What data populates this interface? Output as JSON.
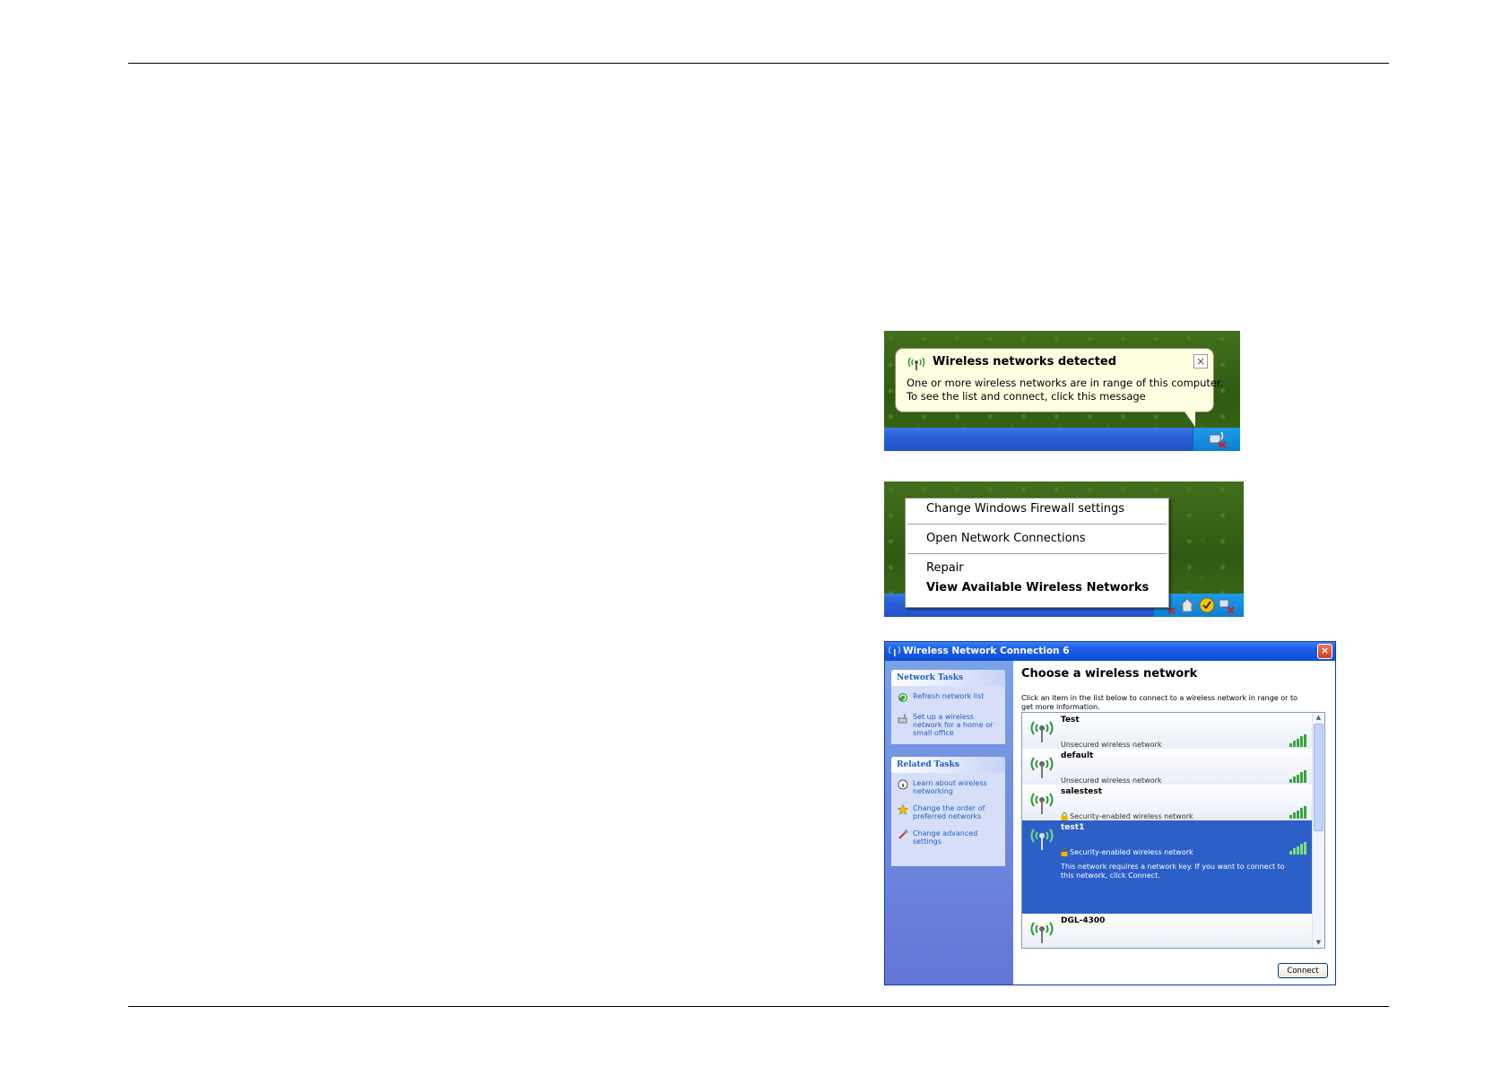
{
  "balloon": {
    "title": "Wireless networks detected",
    "line1": "One or more wireless networks are in range of this computer.",
    "line2": "To see the list and connect, click this message",
    "close_glyph": "×",
    "icon": "wireless-icon"
  },
  "context_menu": {
    "items": [
      "Change Windows Firewall settings",
      "Open Network Connections",
      "Repair",
      "View Available Wireless Networks"
    ]
  },
  "dialog": {
    "title": "Wireless Network Connection 6",
    "close_glyph": "×",
    "network_tasks": {
      "header": "Network Tasks",
      "items": [
        "Refresh network list",
        "Set up a wireless network for a home or small office"
      ]
    },
    "related_tasks": {
      "header": "Related Tasks",
      "items": [
        "Learn about wireless networking",
        "Change the order of preferred networks",
        "Change advanced settings"
      ]
    },
    "main_title": "Choose a wireless network",
    "description": "Click an item in the list below to connect to a wireless network in range or to get more information.",
    "networks": [
      {
        "name": "Test",
        "status": "Unsecured wireless network",
        "secured": false
      },
      {
        "name": "default",
        "status": "Unsecured wireless network",
        "secured": false
      },
      {
        "name": "salestest",
        "status": "Security-enabled wireless network",
        "secured": true
      },
      {
        "name": "test1",
        "status": "Security-enabled wireless network",
        "secured": true,
        "selected": true,
        "extra": "This network requires a network key. If you want to connect to this network, click Connect."
      },
      {
        "name": "DGL-4300",
        "status": "",
        "secured": false
      }
    ],
    "connect_label": "Connect"
  },
  "colors": {
    "taskbar": "#2452c9",
    "selection": "#2d5fc9",
    "balloon_bg": "#ffffe1"
  }
}
